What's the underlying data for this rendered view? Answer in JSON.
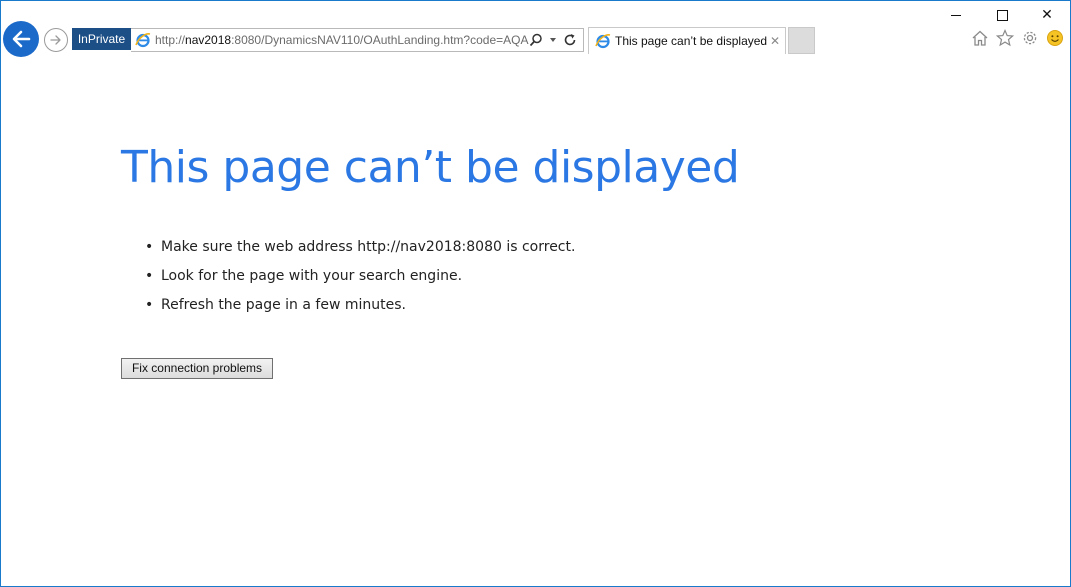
{
  "window": {
    "minimize_icon": "minimize-icon",
    "maximize_icon": "maximize-icon",
    "close_glyph": "✕"
  },
  "nav": {
    "back_icon": "back-arrow-icon",
    "forward_icon": "forward-arrow-icon",
    "inprivate_label": "InPrivate",
    "address": {
      "prefix": "http://",
      "host": "nav2018",
      "rest": ":8080/DynamicsNAV110/OAuthLanding.htm?code=AQA"
    },
    "address_icons": [
      "search-icon",
      "dropdown-icon",
      "refresh-icon"
    ]
  },
  "tab": {
    "title": "This page can’t be displayed",
    "close_glyph": "✕"
  },
  "toolbar_icons": [
    "home-icon",
    "favorites-star-icon",
    "settings-gear-icon",
    "feedback-smiley-icon"
  ],
  "content": {
    "heading": "This page can’t be displayed",
    "bullet": "•",
    "tips": [
      "Make sure the web address http://nav2018:8080 is correct.",
      "Look for the page with your search engine.",
      "Refresh the page in a few minutes."
    ],
    "fix_button_label": "Fix connection problems"
  },
  "colors": {
    "accent": "#2b78e4",
    "back_button": "#1b6ac9",
    "inprivate_badge": "#1d4f87",
    "window_border": "#1979ca"
  }
}
